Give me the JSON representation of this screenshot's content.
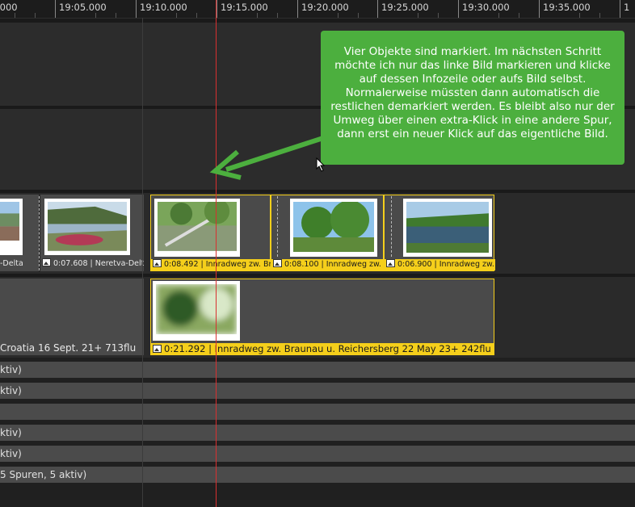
{
  "ruler": {
    "ticks": [
      ".000",
      "19:05.000",
      "19:10.000",
      "19:15.000",
      "19:20.000",
      "19:25.000",
      "19:30.000",
      "19:35.000",
      "1"
    ]
  },
  "clips": {
    "partial_label": "-Delta",
    "neretva": {
      "duration": "0:07.608",
      "title": "Neretva-Delta - Cro..."
    },
    "clip1": {
      "duration": "0:08.492",
      "title": "Innradweg zw. Braunau"
    },
    "clip2": {
      "duration": "0:08.100",
      "title": "Innradweg zw. Braun"
    },
    "clip3": {
      "duration": "0:06.900",
      "title": "Innradweg zw. ..."
    },
    "lower_left_label": "Croatia  16 Sept. 21+  713flu",
    "lower_main": {
      "duration": "0:21.292",
      "title": "Innradweg zw. Braunau u. Reichersberg  22 May 23+  242flu"
    }
  },
  "folders": [
    "ktiv)",
    "ktiv)",
    "",
    "ktiv)",
    "ktiv)",
    "5 Spuren, 5 aktiv)"
  ],
  "callout": {
    "text": "Vier Objekte sind markiert. Im nächsten Schritt möchte ich nur das linke Bild markieren und klicke auf dessen Infozeile oder aufs Bild selbst. Normalerweise müssten dann automatisch die restlichen demarkiert werden. Es bleibt also nur der Umweg über einen extra-Klick in eine andere Spur, dann erst ein neuer Klick auf das eigentliche Bild."
  },
  "colors": {
    "selection": "#f5cf1b",
    "callout": "#4caf3e",
    "playhead": "#d83030"
  }
}
